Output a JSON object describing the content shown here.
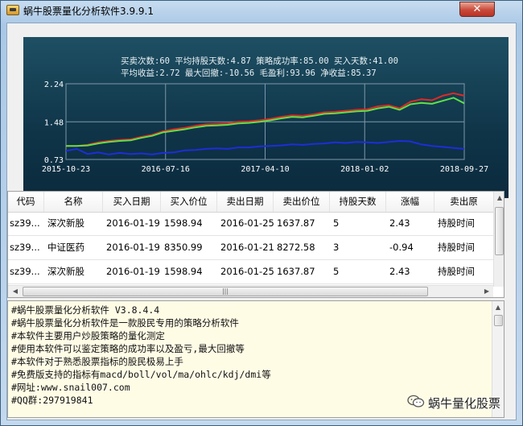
{
  "window": {
    "title": "蜗牛股票量化分析软件3.9.9.1",
    "close_glyph": "✕"
  },
  "stats": {
    "line1": "买卖次数:60 平均持股天数:4.87 策略成功率:85.00 买入天数:41.00",
    "line2": "平均收益:2.72 最大回撤:-10.56 毛盈利:93.96 净收益:85.37"
  },
  "chart_data": {
    "type": "line",
    "x_labels": [
      "2015-10-23",
      "2016-07-16",
      "2017-04-10",
      "2018-01-02",
      "2018-09-27"
    ],
    "y_ticks": [
      2.24,
      1.48,
      0.73
    ],
    "ylim": [
      0.73,
      2.24
    ],
    "grid": true,
    "colors": {
      "red": "#e02a25",
      "green": "#5fe04a",
      "blue": "#1d2ed8",
      "grid": "#7d98a8",
      "axis_text": "#ffffff"
    },
    "series": [
      {
        "color": "red",
        "values": [
          1.0,
          1.0,
          1.02,
          1.07,
          1.1,
          1.12,
          1.13,
          1.18,
          1.22,
          1.29,
          1.33,
          1.36,
          1.4,
          1.43,
          1.44,
          1.45,
          1.48,
          1.49,
          1.51,
          1.54,
          1.58,
          1.61,
          1.6,
          1.63,
          1.67,
          1.68,
          1.7,
          1.72,
          1.73,
          1.79,
          1.81,
          1.75,
          1.88,
          1.93,
          1.91,
          2.0,
          2.05,
          2.0
        ]
      },
      {
        "color": "green",
        "values": [
          1.0,
          1.0,
          1.01,
          1.05,
          1.08,
          1.1,
          1.11,
          1.16,
          1.2,
          1.27,
          1.3,
          1.33,
          1.37,
          1.4,
          1.41,
          1.42,
          1.45,
          1.46,
          1.48,
          1.51,
          1.55,
          1.58,
          1.57,
          1.6,
          1.64,
          1.65,
          1.67,
          1.69,
          1.7,
          1.75,
          1.78,
          1.72,
          1.83,
          1.86,
          1.84,
          1.9,
          1.96,
          1.85
        ]
      },
      {
        "color": "blue",
        "values": [
          0.9,
          0.94,
          0.84,
          0.87,
          0.83,
          0.86,
          0.84,
          0.85,
          0.83,
          0.86,
          0.87,
          0.91,
          0.92,
          0.94,
          0.95,
          0.94,
          0.97,
          0.97,
          0.99,
          1.0,
          1.01,
          1.03,
          1.02,
          1.04,
          1.05,
          1.07,
          1.06,
          1.08,
          1.07,
          1.06,
          1.08,
          1.1,
          1.09,
          1.03,
          1.0,
          0.98,
          0.96,
          0.94
        ]
      }
    ]
  },
  "table": {
    "columns": [
      "代码",
      "名称",
      "买入日期",
      "买入价位",
      "卖出日期",
      "卖出价位",
      "持股天数",
      "涨幅",
      "卖出原"
    ],
    "rows": [
      [
        "sz39...",
        "深次新股",
        "2016-01-19",
        "1598.94",
        "2016-01-25",
        "1637.87",
        "5",
        "2.43",
        "持股时间"
      ],
      [
        "sz39...",
        "中证医药",
        "2016-01-19",
        "8350.99",
        "2016-01-21",
        "8272.58",
        "3",
        "-0.94",
        "持股时间"
      ],
      [
        "sz39...",
        "深次新股",
        "2016-01-19",
        "1598.94",
        "2016-01-25",
        "1637.87",
        "5",
        "2.43",
        "持股时间"
      ]
    ],
    "scroll_left_glyph": "◀",
    "scroll_right_glyph": "▶",
    "scroll_up_glyph": "▲",
    "scroll_grip": "|||"
  },
  "log": {
    "lines": [
      "#蜗牛股票量化分析软件 V3.8.4.4",
      "#蜗牛股票量化分析软件是一款股民专用的策略分析软件",
      "#本软件主要用户炒股策略的量化测定",
      "#使用本软件可以鉴定策略的成功率以及盈亏,最大回撤等",
      "#本软件对于熟悉股票指标的股民极易上手",
      "#免费版支持的指标有macd/boll/vol/ma/ohlc/kdj/dmi等",
      "#网址:www.snail007.com",
      "#QQ群:297919841"
    ]
  },
  "watermark": {
    "text": "蜗牛量化股票"
  }
}
